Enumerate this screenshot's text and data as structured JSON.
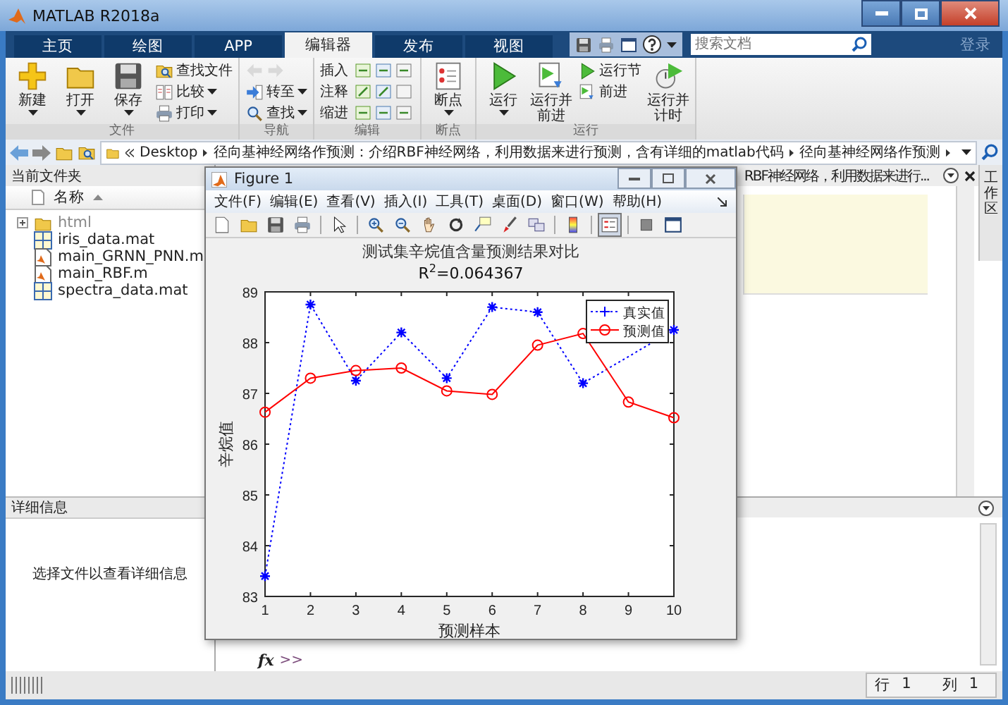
{
  "window": {
    "title": "MATLAB R2018a"
  },
  "tabs": [
    {
      "label": "主页",
      "selected": false
    },
    {
      "label": "绘图",
      "selected": false
    },
    {
      "label": "APP",
      "selected": false
    },
    {
      "label": "编辑器",
      "selected": true
    },
    {
      "label": "发布",
      "selected": false
    },
    {
      "label": "视图",
      "selected": false
    }
  ],
  "search": {
    "placeholder": "搜索文档"
  },
  "login": "登录",
  "ribbon": {
    "groups": [
      {
        "label": "文件",
        "items": [
          {
            "label": "新建",
            "kind": "large",
            "dropdown": true
          },
          {
            "label": "打开",
            "kind": "large",
            "dropdown": true
          },
          {
            "label": "保存",
            "kind": "large",
            "dropdown": true
          },
          {
            "label": "查找文件",
            "kind": "small",
            "dropdown": false
          },
          {
            "label": "比较",
            "kind": "small",
            "dropdown": true
          },
          {
            "label": "打印",
            "kind": "small",
            "dropdown": true
          }
        ]
      },
      {
        "label": "导航",
        "items": [
          {
            "kind": "nav_arrows",
            "disabled": true
          },
          {
            "label": "转至",
            "kind": "small",
            "dropdown": true
          },
          {
            "label": "查找",
            "kind": "small",
            "dropdown": true
          }
        ]
      },
      {
        "label": "编辑",
        "items": [
          {
            "label": "插入",
            "kind": "row"
          },
          {
            "label": "注释",
            "kind": "row"
          },
          {
            "label": "缩进",
            "kind": "row"
          }
        ]
      },
      {
        "label": "断点",
        "items": [
          {
            "label": "断点",
            "kind": "large",
            "dropdown": true
          }
        ]
      },
      {
        "label": "运行",
        "items": [
          {
            "label": "运行",
            "kind": "large",
            "dropdown": true
          },
          {
            "label": "运行并前进",
            "kind": "large",
            "dropdown": false
          },
          {
            "label": "运行节",
            "kind": "small",
            "dropdown": false
          },
          {
            "label": "前进",
            "kind": "small",
            "dropdown": false
          },
          {
            "label": "运行并计时",
            "kind": "large",
            "dropdown": false
          }
        ]
      }
    ]
  },
  "address": {
    "segments": [
      "Desktop",
      "径向基神经网络作预测：介绍RBF神经网络，利用数据来进行预测，含有详细的matlab代码",
      "径向基神经网络作预测"
    ]
  },
  "current_folder": {
    "title": "当前文件夹",
    "column": "名称",
    "files": [
      {
        "name": "html",
        "kind": "folder"
      },
      {
        "name": "iris_data.mat",
        "kind": "mat"
      },
      {
        "name": "main_GRNN_PNN.m",
        "kind": "m"
      },
      {
        "name": "main_RBF.m",
        "kind": "m"
      },
      {
        "name": "spectra_data.mat",
        "kind": "mat"
      }
    ]
  },
  "details": {
    "title": "详细信息",
    "message": "选择文件以查看详细信息"
  },
  "editor": {
    "tab_title": "RBF神经网络，利用数据来进行..."
  },
  "side_tab": "工作区",
  "command_window": {
    "function_button": "fx",
    "prompt": ">>"
  },
  "status": {
    "row_label": "行",
    "row": "1",
    "col_label": "列",
    "col": "1"
  },
  "figure": {
    "title": "Figure 1",
    "menu": [
      "文件(F)",
      "编辑(E)",
      "查看(V)",
      "插入(I)",
      "工具(T)",
      "桌面(D)",
      "窗口(W)",
      "帮助(H)"
    ],
    "toolbar": [
      {
        "selected": false
      },
      {
        "selected": false
      },
      {
        "selected": false
      },
      {
        "selected": false
      },
      {
        "selected": false
      },
      {
        "selected": false
      },
      {
        "selected": false
      },
      {
        "selected": false
      },
      {
        "selected": false
      },
      {
        "selected": false
      },
      {
        "selected": false
      },
      {
        "selected": false
      },
      {
        "selected": false
      },
      {
        "selected": true
      },
      {
        "selected": false
      },
      {
        "selected": false
      }
    ],
    "chart_data": {
      "type": "line",
      "title": "测试集辛烷值含量预测结果对比",
      "subtitle": "R$^{2}$=0.064367",
      "xlabel": "预测样本",
      "ylabel": "辛烷值",
      "x": [
        1,
        2,
        3,
        4,
        5,
        6,
        7,
        8,
        9,
        10
      ],
      "series": [
        {
          "name": "真实值",
          "color": "#0000ff",
          "marker": "cross",
          "line_style": "dotted",
          "values": [
            83.4,
            88.75,
            87.25,
            88.2,
            87.3,
            88.7,
            88.6,
            87.2,
            null,
            88.25
          ]
        },
        {
          "name": "预测值",
          "color": "#ff0000",
          "marker": "circle",
          "line_style": "solid",
          "values": [
            86.63,
            87.3,
            87.45,
            87.5,
            87.05,
            86.98,
            87.95,
            88.18,
            86.83,
            86.52
          ]
        }
      ],
      "legend": "upper right",
      "xlim": [
        1,
        10
      ],
      "ylim": [
        83,
        89
      ],
      "xticks": [
        1,
        2,
        3,
        4,
        5,
        6,
        7,
        8,
        9,
        10
      ],
      "yticks": [
        83,
        84,
        85,
        86,
        87,
        88,
        89
      ]
    }
  }
}
